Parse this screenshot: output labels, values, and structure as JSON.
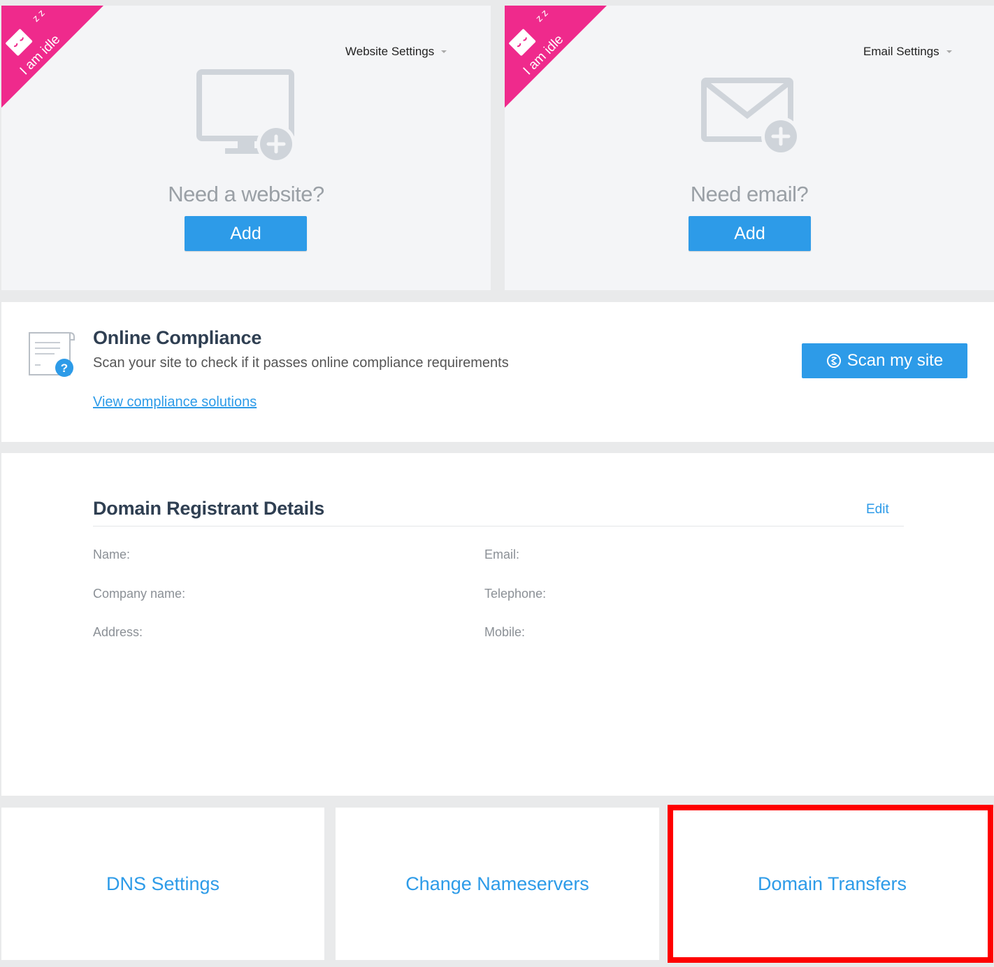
{
  "website_card": {
    "ribbon_text": "I am idle",
    "ribbon_zz": "z z",
    "settings_label": "Website Settings",
    "prompt": "Need a website?",
    "add_label": "Add"
  },
  "email_card": {
    "ribbon_text": "I am idle",
    "ribbon_zz": "z z",
    "settings_label": "Email Settings",
    "prompt": "Need email?",
    "add_label": "Add"
  },
  "compliance": {
    "title": "Online Compliance",
    "description": "Scan your site to check if it passes online compliance requirements",
    "link": "View compliance solutions",
    "scan_label": "Scan my site"
  },
  "registrant": {
    "title": "Domain Registrant Details",
    "edit_label": "Edit",
    "fields": {
      "name": "Name:",
      "company": "Company name:",
      "address": "Address:",
      "email": "Email:",
      "telephone": "Telephone:",
      "mobile": "Mobile:"
    }
  },
  "links": {
    "dns": "DNS Settings",
    "nameservers": "Change Nameservers",
    "transfers": "Domain Transfers"
  },
  "colors": {
    "accent": "#2d9be8",
    "ribbon": "#ef2a8c",
    "highlight": "#ff0000",
    "card_bg": "#f4f5f7"
  }
}
